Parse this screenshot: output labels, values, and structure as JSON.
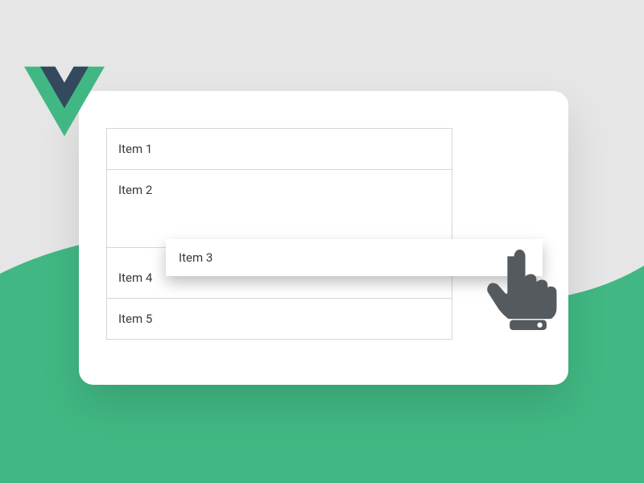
{
  "list": {
    "items": [
      {
        "label": "Item 1"
      },
      {
        "label": "Item 2"
      },
      {
        "label": "Item 3"
      },
      {
        "label": "Item 4"
      },
      {
        "label": "Item 5"
      }
    ]
  },
  "icons": {
    "logo": "vue-logo",
    "pointer": "pointer-hand-icon"
  }
}
